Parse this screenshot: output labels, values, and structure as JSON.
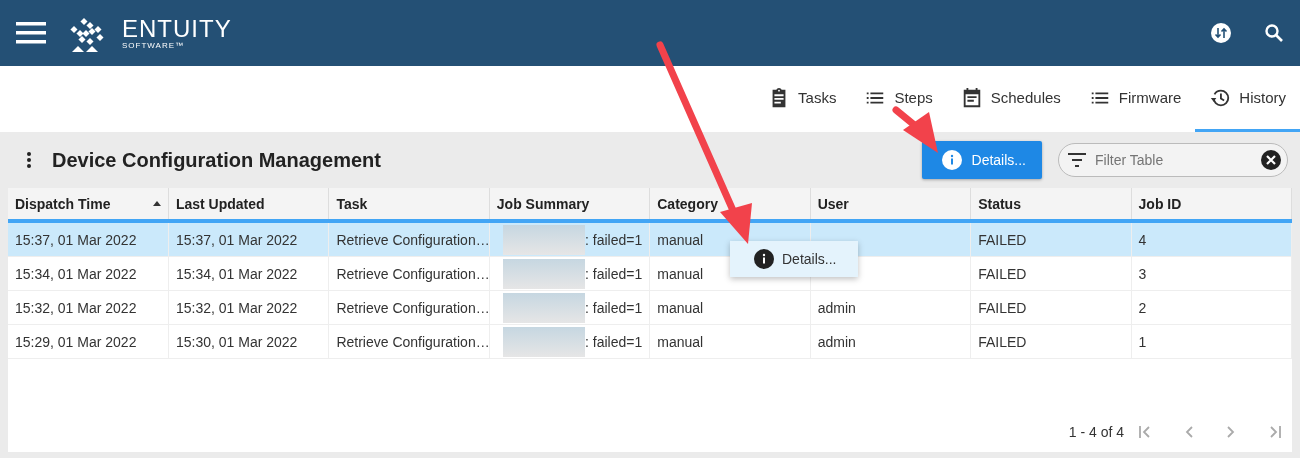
{
  "header": {
    "logo_name": "ENTUITY",
    "logo_sub": "SOFTWARE™"
  },
  "tabs": [
    {
      "label": "Tasks",
      "selected": false
    },
    {
      "label": "Steps",
      "selected": false
    },
    {
      "label": "Schedules",
      "selected": false
    },
    {
      "label": "Firmware",
      "selected": false
    },
    {
      "label": "History",
      "selected": true
    }
  ],
  "page_title": "Device Configuration Management",
  "details_button": "Details...",
  "filter": {
    "placeholder": "Filter Table"
  },
  "table": {
    "columns": [
      {
        "label": "Dispatch Time",
        "sorted": true
      },
      {
        "label": "Last Updated",
        "sorted": false
      },
      {
        "label": "Task",
        "sorted": false
      },
      {
        "label": "Job Summary",
        "sorted": false
      },
      {
        "label": "Category",
        "sorted": false
      },
      {
        "label": "User",
        "sorted": false
      },
      {
        "label": "Status",
        "sorted": false
      },
      {
        "label": "Job ID",
        "sorted": false
      }
    ],
    "rows": [
      {
        "selected": true,
        "redacted": true,
        "cells": [
          "15:37, 01 Mar 2022",
          "15:37, 01 Mar 2022",
          "Retrieve Configuration…",
          ": failed=1",
          "manual",
          null,
          "FAILED",
          "4"
        ]
      },
      {
        "selected": false,
        "redacted": true,
        "cells": [
          "15:34, 01 Mar 2022",
          "15:34, 01 Mar 2022",
          "Retrieve Configuration…",
          ": failed=1",
          "manual",
          null,
          "FAILED",
          "3"
        ]
      },
      {
        "selected": false,
        "redacted": true,
        "cells": [
          "15:32, 01 Mar 2022",
          "15:32, 01 Mar 2022",
          "Retrieve Configuration…",
          ": failed=1",
          "manual",
          "admin",
          "FAILED",
          "2"
        ]
      },
      {
        "selected": false,
        "redacted": true,
        "cells": [
          "15:29, 01 Mar 2022",
          "15:30, 01 Mar 2022",
          "Retrieve Configuration…",
          ": failed=1",
          "manual",
          "admin",
          "FAILED",
          "1"
        ]
      }
    ]
  },
  "context_menu": {
    "items": [
      "Details..."
    ]
  },
  "pagination": {
    "range": "1 - 4 of 4"
  }
}
